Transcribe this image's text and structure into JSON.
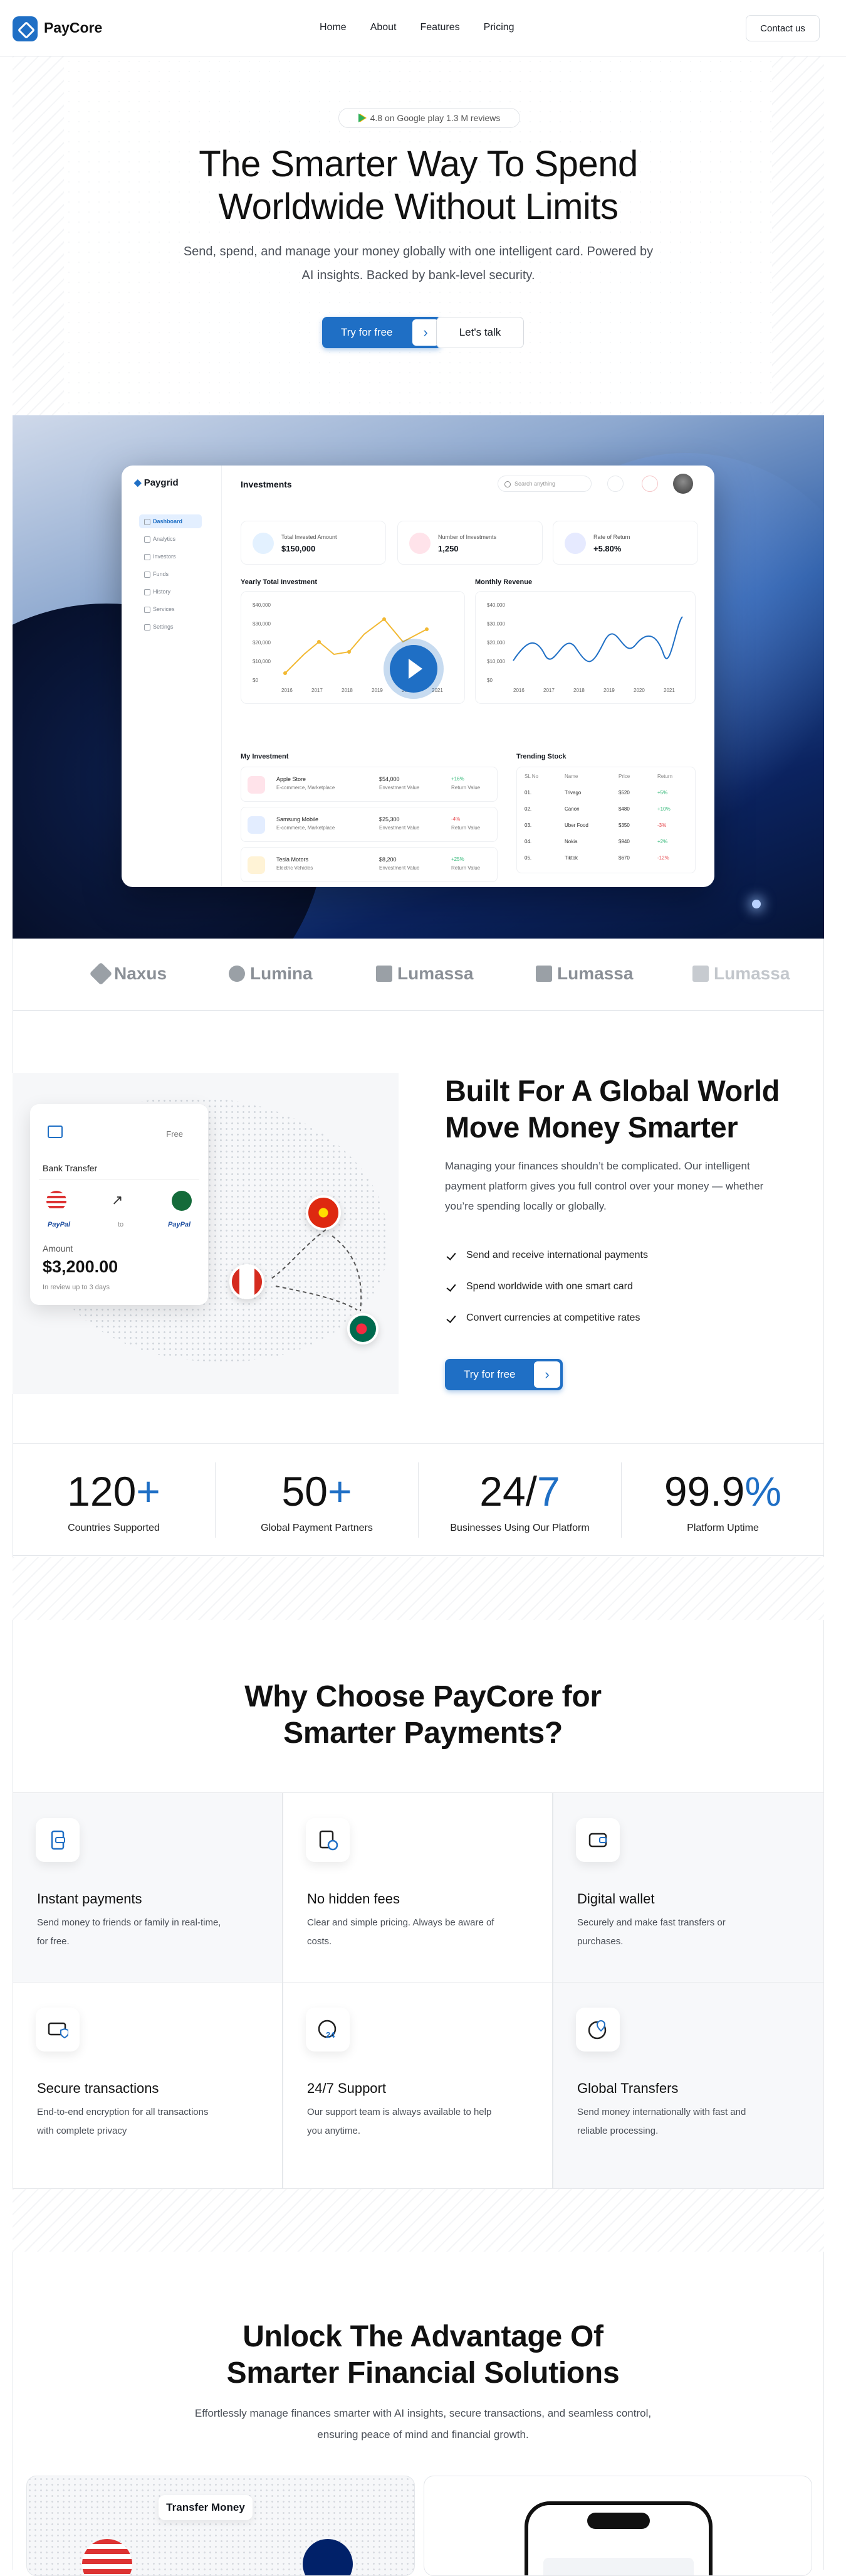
{
  "nav": {
    "brand": "PayCore",
    "links": [
      "Home",
      "About",
      "Features",
      "Pricing"
    ],
    "cta": "Contact us"
  },
  "hero": {
    "rating": "4.8 on Google play 1.3 M reviews",
    "title_line1": "The Smarter Way To Spend",
    "title_line2": "Worldwide Without Limits",
    "subtitle": "Send, spend, and manage your money globally with one intelligent card. Powered by AI insights. Backed by bank-level security.",
    "primary_cta": "Try for free",
    "secondary_cta": "Let's talk"
  },
  "dashboard": {
    "brand": "Paygrid",
    "title": "Investments",
    "search_placeholder": "Search anything",
    "sidebar": [
      "Dashboard",
      "Analytics",
      "Investors",
      "Funds",
      "History",
      "Services",
      "Settings"
    ],
    "stats": [
      {
        "label": "Total Invested Amount",
        "value": "$150,000"
      },
      {
        "label": "Number of Investments",
        "value": "1,250"
      },
      {
        "label": "Rate of Return",
        "value": "+5.80%"
      }
    ],
    "yearly_title": "Yearly Total Investment",
    "monthly_title": "Monthly Revenue",
    "yearly_yticks": [
      "$40,000",
      "$30,000",
      "$20,000",
      "$10,000",
      "$0"
    ],
    "monthly_yticks": [
      "$40,000",
      "$30,000",
      "$20,000",
      "$10,000",
      "$0"
    ],
    "years": [
      "2016",
      "2017",
      "2018",
      "2019",
      "2020",
      "2021"
    ],
    "my_investment_title": "My Investment",
    "investments": [
      {
        "name": "Apple Store",
        "sector": "E-commerce, Marketplace",
        "value": "$54,000",
        "value_label": "Envestment Value",
        "return": "+16%",
        "return_label": "Return Value",
        "color": "#2bb673"
      },
      {
        "name": "Samsung Mobile",
        "sector": "E-commerce, Marketplace",
        "value": "$25,300",
        "value_label": "Envestment Value",
        "return": "-4%",
        "return_label": "Return Value",
        "color": "#e5484d"
      },
      {
        "name": "Tesla Motors",
        "sector": "Electric Vehicles",
        "value": "$8,200",
        "value_label": "Envestment Value",
        "return": "+25%",
        "return_label": "Return Value",
        "color": "#2bb673"
      }
    ],
    "trending_title": "Trending Stock",
    "trending_headers": [
      "SL No",
      "Name",
      "Price",
      "Return"
    ],
    "trending": [
      [
        "01.",
        "Trivago",
        "$520",
        "+5%"
      ],
      [
        "02.",
        "Canon",
        "$480",
        "+10%"
      ],
      [
        "03.",
        "Uber Food",
        "$350",
        "-3%"
      ],
      [
        "04.",
        "Nokia",
        "$940",
        "+2%"
      ],
      [
        "05.",
        "Tiktok",
        "$670",
        "-12%"
      ]
    ]
  },
  "logos": [
    "Naxus",
    "Lumina",
    "Lumassa",
    "Lumassa",
    "Lumassa"
  ],
  "global": {
    "card_label": "Bank Transfer",
    "card_tag": "Free",
    "paypal": "PayPal",
    "to": "to",
    "amount_label": "Amount",
    "amount": "$3,200.00",
    "amount_note": "In review up to 3 days",
    "title_line1": "Built For A Global World",
    "title_line2": "Move Money Smarter",
    "text": "Managing your finances shouldn’t be complicated. Our intelligent payment platform gives you full control over your money — whether you’re spending locally or globally.",
    "checks": [
      "Send and receive international payments",
      "Spend worldwide with one smart card",
      "Convert currencies at competitive rates"
    ],
    "cta": "Try for free"
  },
  "stats": [
    {
      "num": "120",
      "suffix": "+",
      "caption": "Countries Supported"
    },
    {
      "num": "50",
      "suffix": "+",
      "caption": "Global Payment Partners"
    },
    {
      "num": "24/",
      "suffix": "7",
      "caption": "Businesses Using Our Platform"
    },
    {
      "num": "99.9",
      "suffix": "%",
      "caption": "Platform Uptime"
    }
  ],
  "why": {
    "title_line1": "Why Choose PayCore for",
    "title_line2": "Smarter Payments?",
    "features": [
      {
        "title": "Instant payments",
        "desc": "Send money to friends or family in real-time, for free.",
        "icon": "phone-payment-icon"
      },
      {
        "title": "No hidden fees",
        "desc": "Clear and simple pricing. Always be aware of costs.",
        "icon": "invoice-icon"
      },
      {
        "title": "Digital wallet",
        "desc": "Securely and make fast transfers or purchases.",
        "icon": "wallet-icon"
      },
      {
        "title": "Secure transactions",
        "desc": "End-to-end encryption for all transactions with complete privacy",
        "icon": "secure-card-icon"
      },
      {
        "title": "24/7 Support",
        "desc": "Our support team is always available to help you anytime.",
        "icon": "clock-24-icon"
      },
      {
        "title": "Global Transfers",
        "desc": "Send money internationally with fast and reliable processing.",
        "icon": "globe-pin-icon"
      }
    ]
  },
  "unlock": {
    "title_line1": "Unlock The Advantage Of",
    "title_line2": "Smarter Financial Solutions",
    "subtitle": "Effortlessly manage finances smarter with AI insights, secure transactions, and seamless control, ensuring peace of mind and financial growth.",
    "card_label": "Transfer Money"
  },
  "colors": {
    "accent": "#1f6fc5",
    "positive": "#2bb673",
    "negative": "#e5484d",
    "chart_yellow": "#f2b933"
  }
}
